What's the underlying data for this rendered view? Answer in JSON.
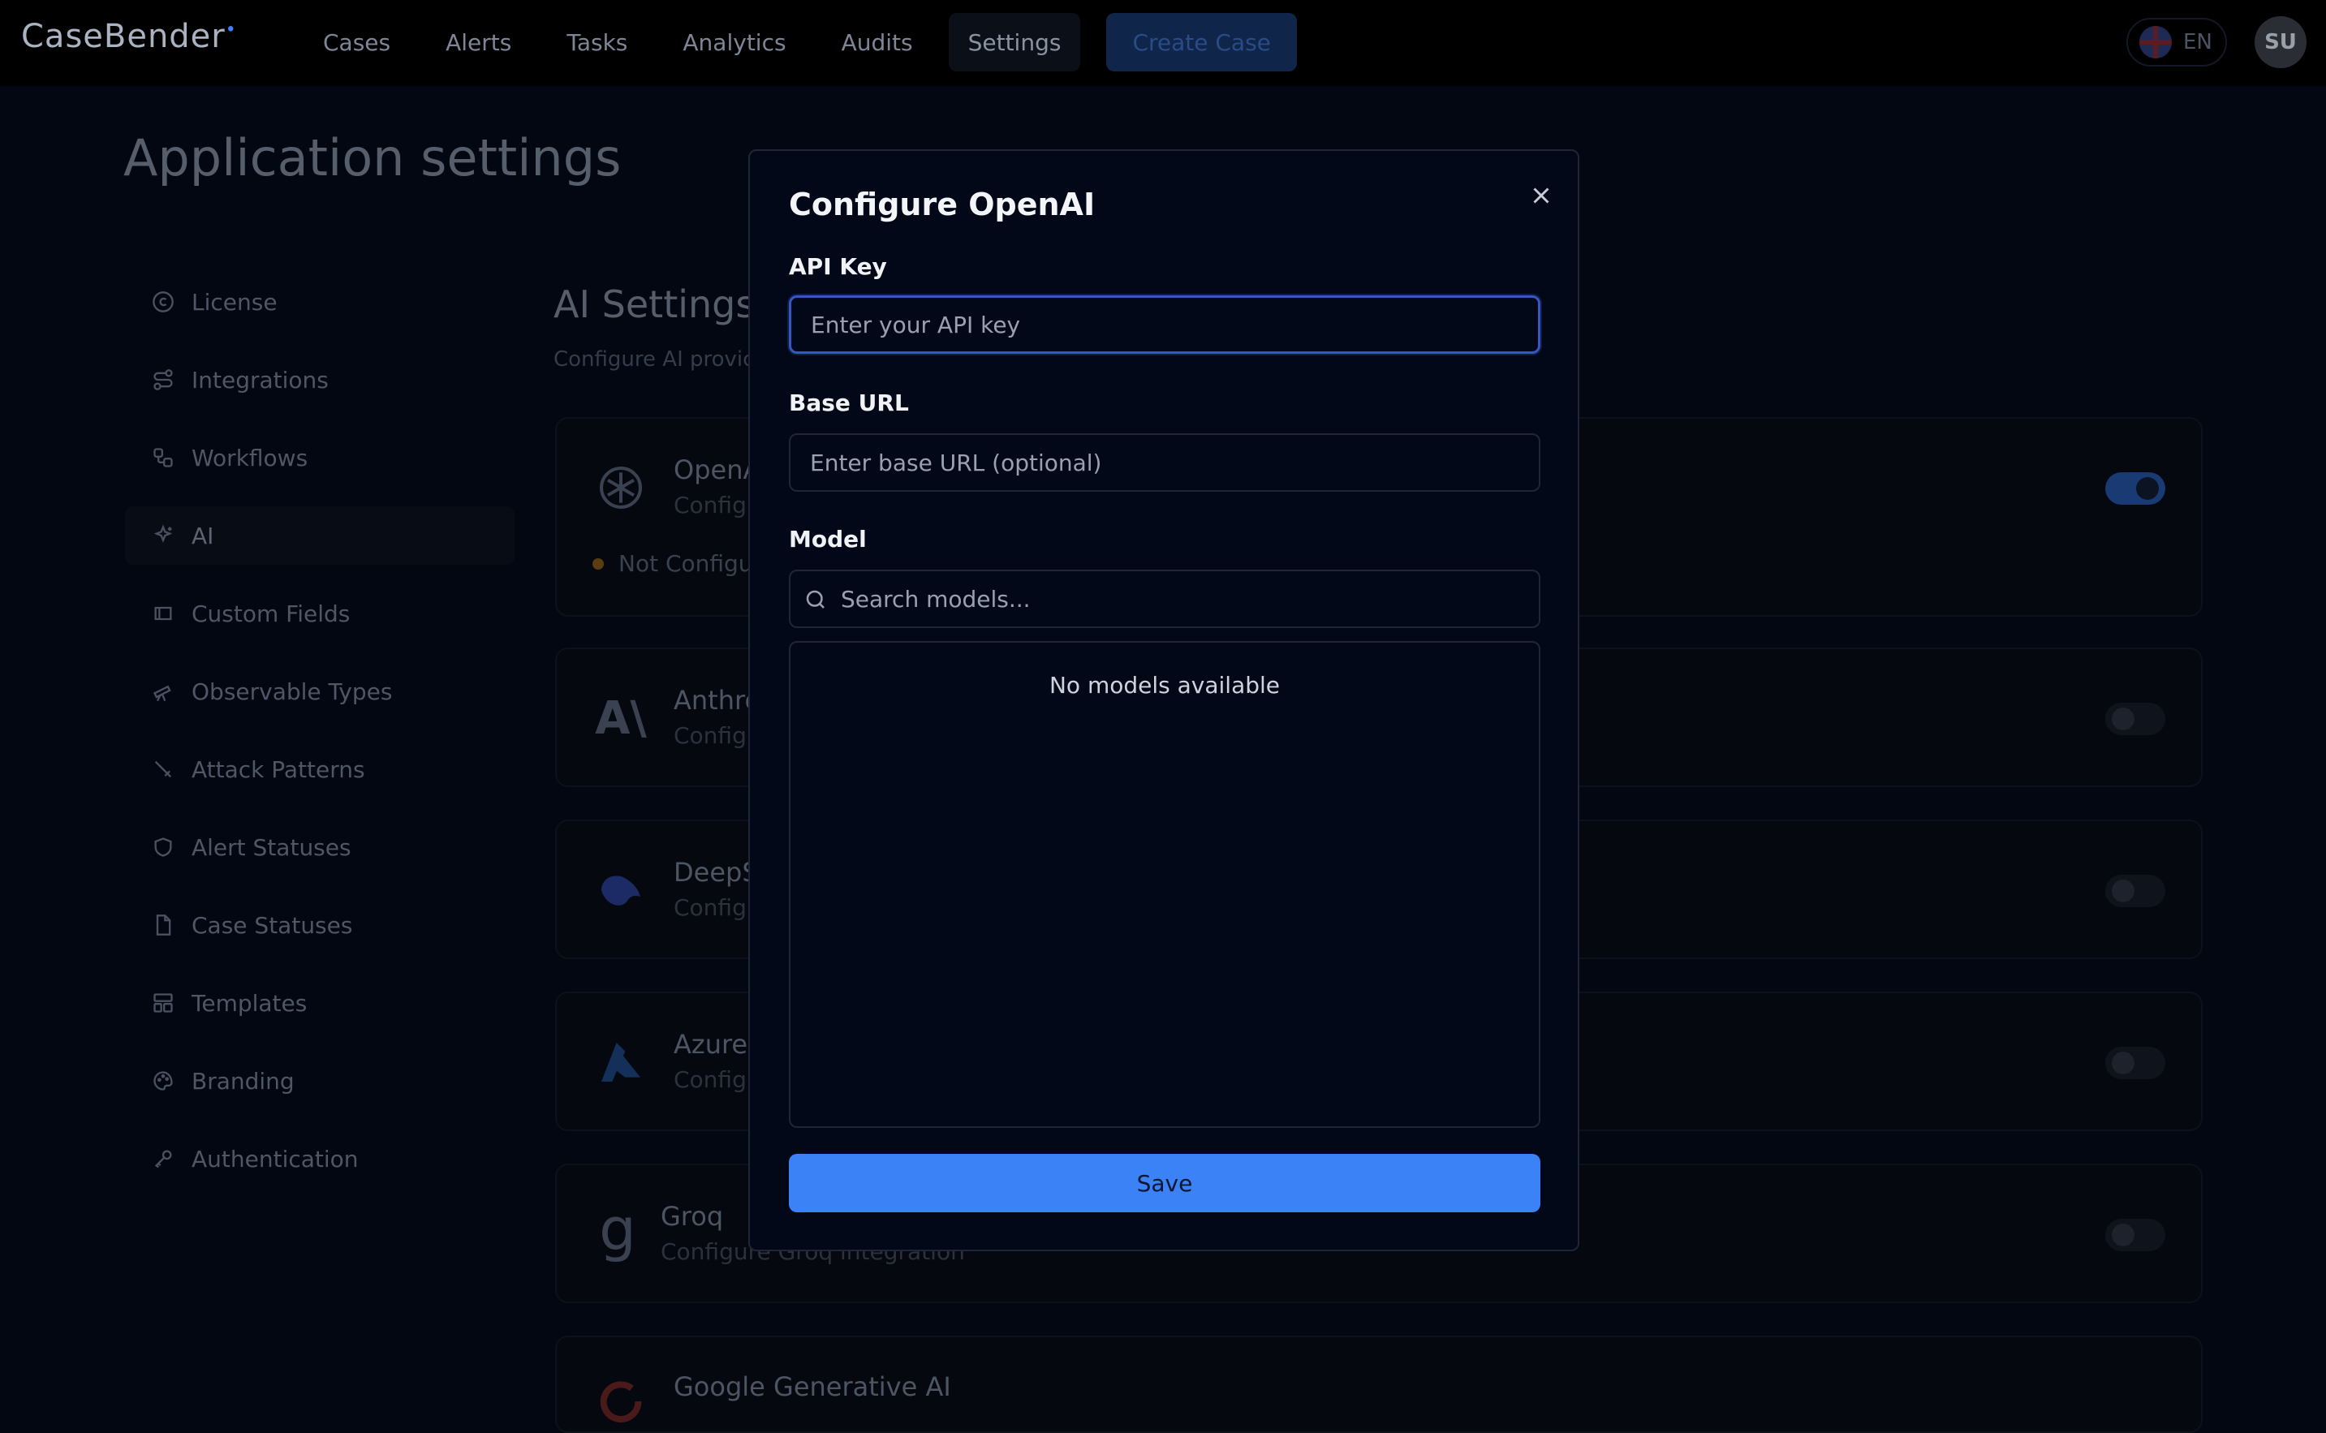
{
  "app": {
    "logo": "CaseBender",
    "nav": [
      "Cases",
      "Alerts",
      "Tasks",
      "Analytics",
      "Audits",
      "Settings"
    ],
    "active_nav": "Settings",
    "create_case": "Create Case",
    "language": "EN",
    "user_initials": "SU"
  },
  "page": {
    "title": "Application settings",
    "sidebar": [
      {
        "label": "License",
        "icon": "copyright-icon"
      },
      {
        "label": "Integrations",
        "icon": "integrations-icon"
      },
      {
        "label": "Workflows",
        "icon": "workflow-icon"
      },
      {
        "label": "AI",
        "icon": "sparkles-icon",
        "active": true
      },
      {
        "label": "Custom Fields",
        "icon": "custom-fields-icon"
      },
      {
        "label": "Observable Types",
        "icon": "telescope-icon"
      },
      {
        "label": "Attack Patterns",
        "icon": "sword-icon"
      },
      {
        "label": "Alert Statuses",
        "icon": "shield-icon"
      },
      {
        "label": "Case Statuses",
        "icon": "file-icon"
      },
      {
        "label": "Templates",
        "icon": "layout-icon"
      },
      {
        "label": "Branding",
        "icon": "palette-icon"
      },
      {
        "label": "Authentication",
        "icon": "key-icon"
      }
    ],
    "section_title": "AI Settings",
    "section_subtitle": "Configure AI provic",
    "providers": [
      {
        "name": "OpenA",
        "desc": "Configu",
        "status": "Not Configu",
        "enabled": true
      },
      {
        "name": "Anthro",
        "desc": "Configu",
        "enabled": false
      },
      {
        "name": "DeepS",
        "desc": "Configu",
        "enabled": false
      },
      {
        "name": "Azure (",
        "desc": "Configu",
        "enabled": false
      },
      {
        "name": "Groq",
        "desc": "Configure Groq integration",
        "enabled": false
      },
      {
        "name": "Google Generative AI",
        "desc": "",
        "enabled": false
      }
    ]
  },
  "modal": {
    "title": "Configure OpenAI",
    "api_key_label": "API Key",
    "api_key_placeholder": "Enter your API key",
    "api_key_value": "",
    "base_url_label": "Base URL",
    "base_url_placeholder": "Enter base URL (optional)",
    "base_url_value": "",
    "model_label": "Model",
    "model_search_placeholder": "Search models...",
    "models_empty": "No models available",
    "save_label": "Save"
  }
}
